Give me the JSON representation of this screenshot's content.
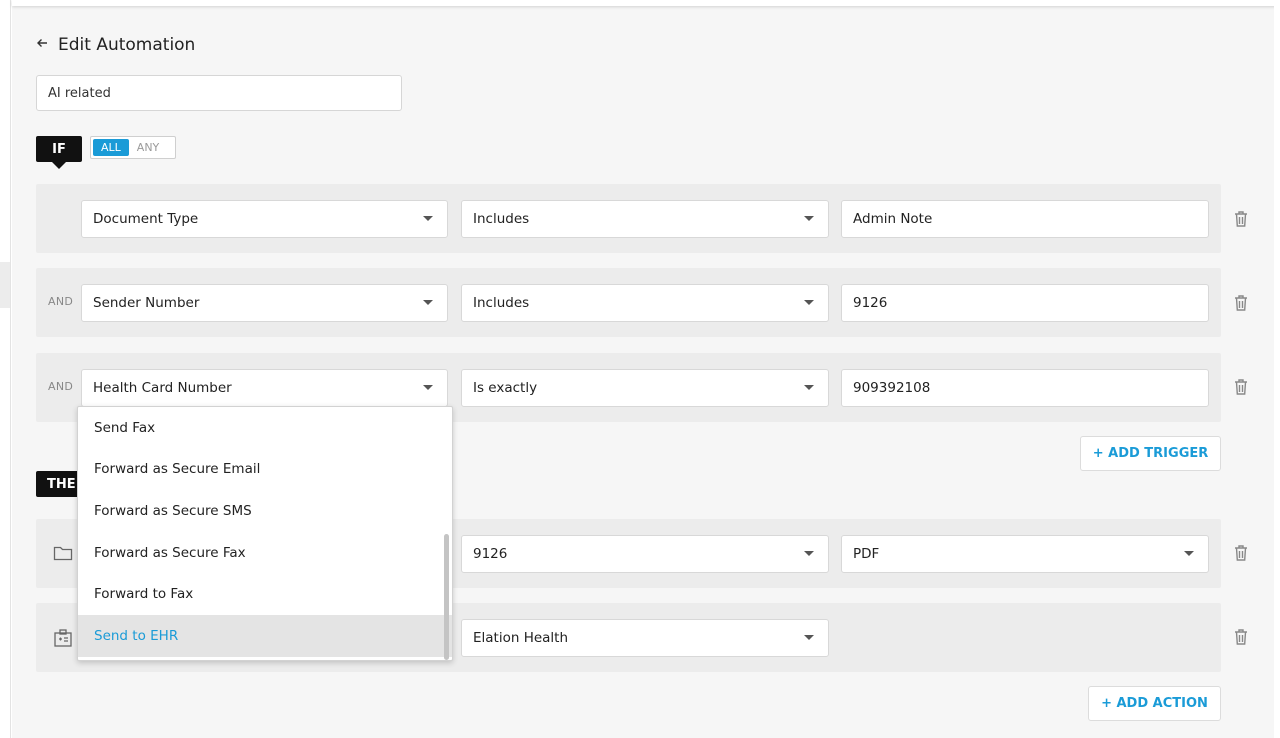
{
  "header": {
    "back_icon": "arrow-left-icon",
    "title": "Edit Automation"
  },
  "automation_name": "AI related",
  "if_section": {
    "badge": "IF",
    "match_options": [
      "ALL",
      "ANY"
    ],
    "selected_match": "ALL",
    "triggers": [
      {
        "connector": "",
        "field": "Document Type",
        "operator": "Includes",
        "value": "Admin Note"
      },
      {
        "connector": "AND",
        "field": "Sender Number",
        "operator": "Includes",
        "value": "9126"
      },
      {
        "connector": "AND",
        "field": "Health Card Number",
        "operator": "Is exactly",
        "value": "909392108"
      }
    ],
    "add_trigger_label": "+ ADD TRIGGER"
  },
  "then_section": {
    "badge": "THE",
    "actions": [
      {
        "icon": "folder-icon",
        "target": "9126",
        "format": "PDF"
      },
      {
        "icon": "medical-record-icon",
        "target": "Elation Health"
      }
    ],
    "add_action_label": "+ ADD ACTION"
  },
  "action_dropdown": {
    "options": [
      "Send Fax",
      "Forward as Secure Email",
      "Forward as Secure SMS",
      "Forward as Secure Fax",
      "Forward to Fax",
      "Send to EHR"
    ],
    "selected": "Send to EHR"
  },
  "colors": {
    "accent": "#1a9bd7",
    "badge": "#111111",
    "row_bg": "#ececec",
    "page_bg": "#f6f6f6"
  }
}
